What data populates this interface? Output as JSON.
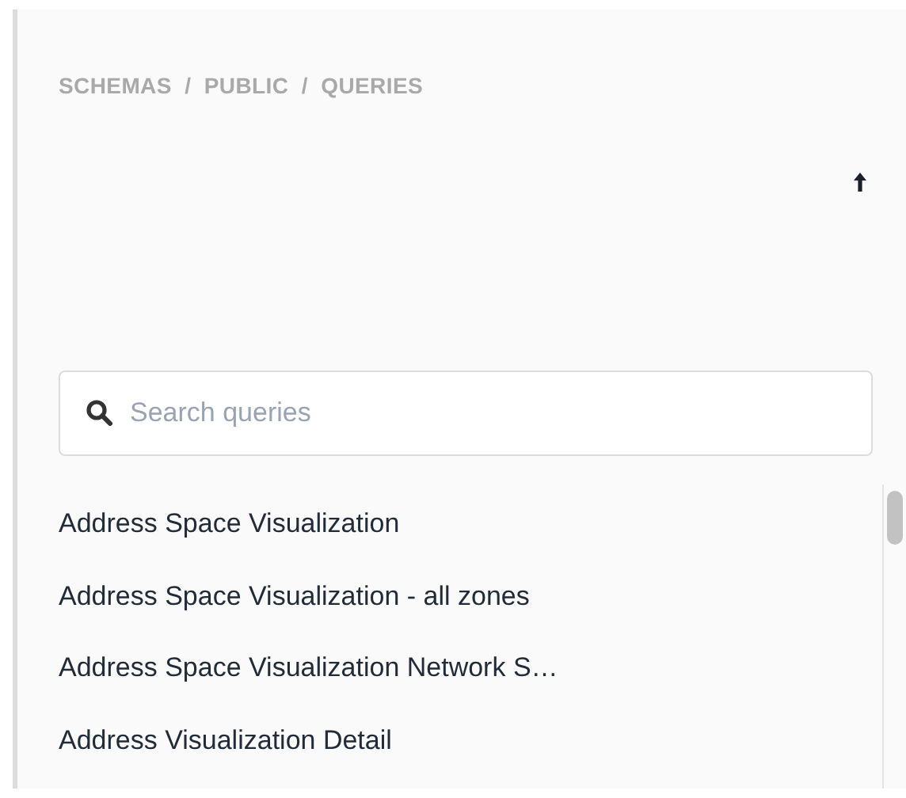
{
  "breadcrumb": "SCHEMAS  /  PUBLIC  /  QUERIES",
  "search": {
    "placeholder": "Search queries"
  },
  "queries": [
    {
      "name": "Address Space Visualization"
    },
    {
      "name": "Address Space Visualization - all zones"
    },
    {
      "name": "Address Space Visualization Network S…"
    },
    {
      "name": "Address Visualization Detail"
    }
  ]
}
